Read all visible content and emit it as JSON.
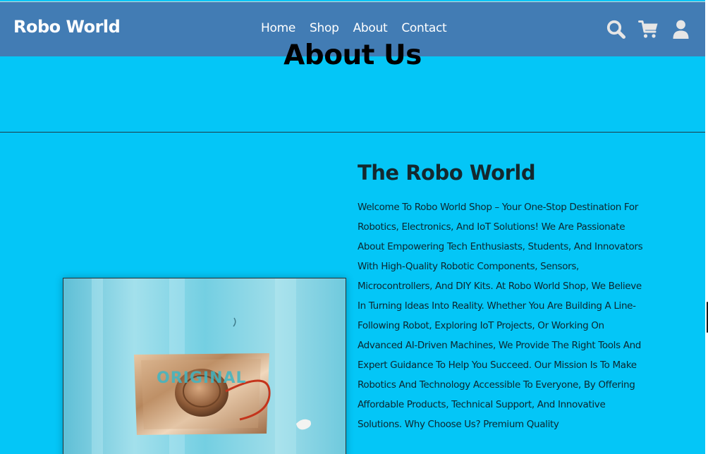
{
  "header": {
    "brand": "Robo World",
    "nav": [
      "Home",
      "Shop",
      "About",
      "Contact"
    ],
    "icons": [
      "search-icon",
      "cart-icon",
      "user-icon"
    ]
  },
  "hero": {
    "title": "About Us"
  },
  "about": {
    "title": "The Robo World",
    "body": "Welcome To Robo World Shop – Your One-Stop Destination For Robotics, Electronics, And IoT Solutions! We Are Passionate About Empowering Tech Enthusiasts, Students, And Innovators With High-Quality Robotic Components, Sensors, Microcontrollers, And DIY Kits. At Robo World Shop, We Believe In Turning Ideas Into Reality. Whether You Are Building A Line-Following Robot, Exploring IoT Projects, Or Working On Advanced AI-Driven Machines, We Provide The Right Tools And Expert Guidance To Help You Succeed. Our Mission Is To Make Robotics And Technology Accessible To Everyone, By Offering Affordable Products, Technical Support, And Innovative Solutions. Why Choose Us? Premium Quality",
    "image_label": "ORIGINAL"
  },
  "colors": {
    "page_background": "#04c6f7",
    "navbar": "#427cb4",
    "nav_text": "#ffffff",
    "icon": "#e6e6e6",
    "heading": "#14282e"
  }
}
